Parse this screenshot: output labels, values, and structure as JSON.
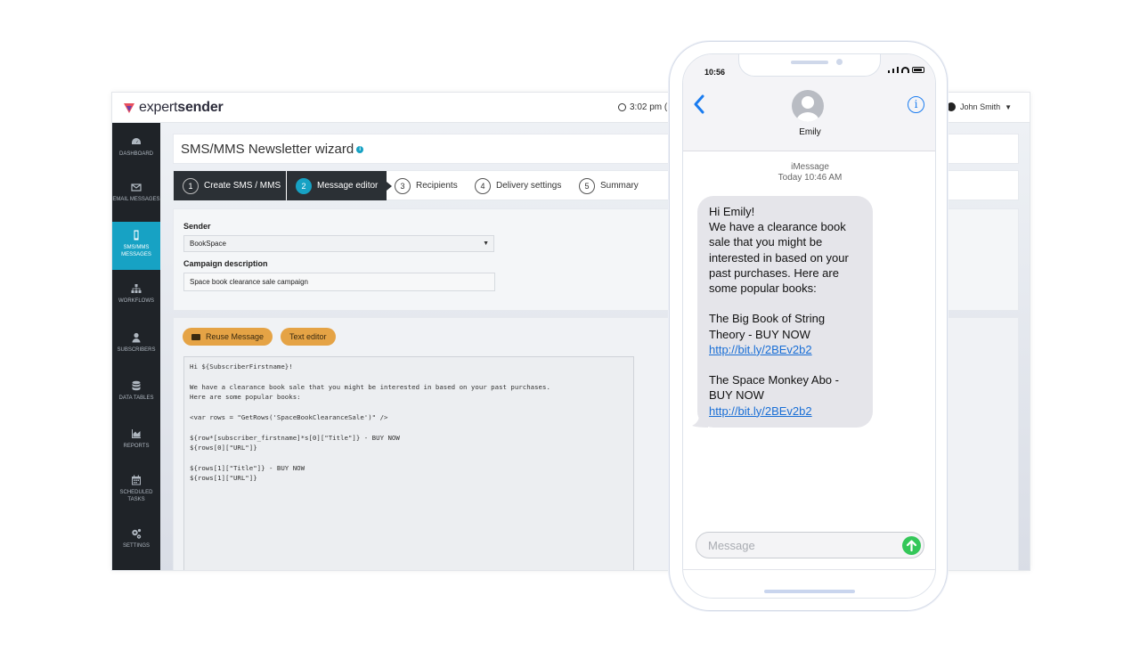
{
  "app": {
    "brand": {
      "prefix": "expert",
      "suffix": "sender"
    },
    "clock": "3:02 pm (U",
    "user": "John Smith",
    "sidebar": [
      {
        "label": "DASHBOARD",
        "icon": "dashboard-icon"
      },
      {
        "label": "EMAIL MESSAGES",
        "icon": "envelope-icon"
      },
      {
        "label": "SMS/MMS MESSAGES",
        "icon": "mobile-icon",
        "active": true
      },
      {
        "label": "WORKFLOWS",
        "icon": "sitemap-icon"
      },
      {
        "label": "SUBSCRIBERS",
        "icon": "user-icon"
      },
      {
        "label": "DATA TABLES",
        "icon": "database-icon"
      },
      {
        "label": "REPORTS",
        "icon": "area-chart-icon"
      },
      {
        "label": "SCHEDULED TASKS",
        "icon": "calendar-icon"
      },
      {
        "label": "SETTINGS",
        "icon": "cogs-icon"
      }
    ],
    "wizard_title": "SMS/MMS Newsletter wizard",
    "steps": [
      {
        "num": "1",
        "label": "Create SMS / MMS"
      },
      {
        "num": "2",
        "label": "Message editor"
      },
      {
        "num": "3",
        "label": "Recipients"
      },
      {
        "num": "4",
        "label": "Delivery settings"
      },
      {
        "num": "5",
        "label": "Summary"
      }
    ],
    "form": {
      "sender_label": "Sender",
      "sender_value": "BookSpace",
      "campaign_label": "Campaign description",
      "campaign_value": "Space book clearance sale campaign"
    },
    "editor": {
      "reuse_label": "Reuse Message",
      "text_editor_label": "Text editor",
      "code": "Hi ${SubscriberFirstname}!\n\nWe have a clearance book sale that you might be interested in based on your past purchases.\nHere are some popular books:\n\n<var rows = \"GetRows('SpaceBookClearanceSale')\" />\n\n${row*[subscriber_firstname]*s[0][\"Title\"]} - BUY NOW\n${rows[0][\"URL\"]}\n\n${rows[1][\"Title\"]} - BUY NOW\n${rows[1][\"URL\"]}"
    },
    "colors": {
      "accent": "#17a2c4",
      "sidebar": "#1f2328",
      "pill": "#e5a345"
    }
  },
  "phone": {
    "status_time": "10:56",
    "contact_name": "Emily",
    "thread_service": "iMessage",
    "thread_time": "Today 10:46 AM",
    "message": {
      "greeting": "Hi Emily!",
      "body": "We have a clearance book sale that you might be interested in based on your past purchases. Here are some popular books:",
      "book1": "The Big Book of String Theory - BUY NOW",
      "link1": "http://bit.ly/2BEv2b2",
      "book2": "The Space Monkey Abo - BUY NOW",
      "link2": "http://bit.ly/2BEv2b2"
    },
    "compose_placeholder": "Message",
    "colors": {
      "bubble": "#e5e5ea",
      "link": "#1a6fd6",
      "send": "#34c759",
      "ios_blue": "#1a7cf0"
    }
  }
}
